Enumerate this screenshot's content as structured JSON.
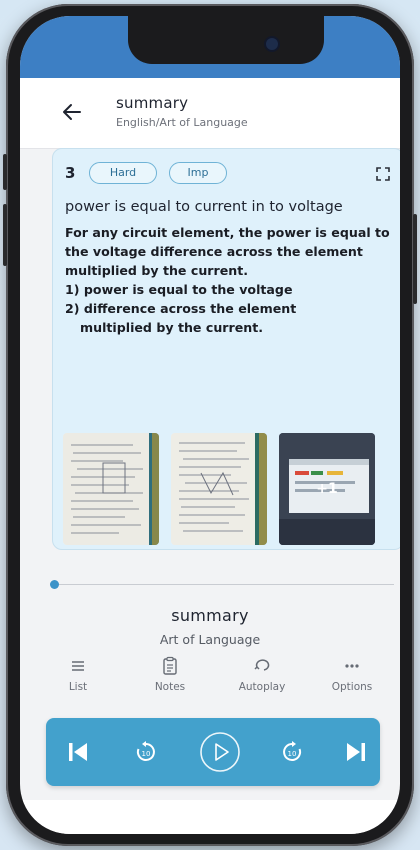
{
  "header": {
    "title": "summary",
    "breadcrumb": "English/Art of Language"
  },
  "card": {
    "number": "3",
    "tags": [
      "Hard",
      "Imp"
    ],
    "heading": "power is equal to current in to voltage",
    "body_lines": [
      "For any circuit element, the power is equal to",
      "the voltage difference across the element",
      "multiplied by the current.",
      "1) power is equal to the voltage",
      "2) difference across the element",
      "multiplied by the current."
    ],
    "extra_images": "+1"
  },
  "player": {
    "progress_fraction": 0.0,
    "track_title": "summary",
    "track_subtitle": "Art of Language"
  },
  "actions": [
    {
      "label": "List",
      "icon": "list-icon"
    },
    {
      "label": "Notes",
      "icon": "notes-icon"
    },
    {
      "label": "Autoplay",
      "icon": "autoplay-icon"
    },
    {
      "label": "Options",
      "icon": "more-icon"
    }
  ],
  "colors": {
    "accent": "#43a1cc",
    "status_bar": "#3d7fc4",
    "card_bg": "#dff1fb"
  }
}
